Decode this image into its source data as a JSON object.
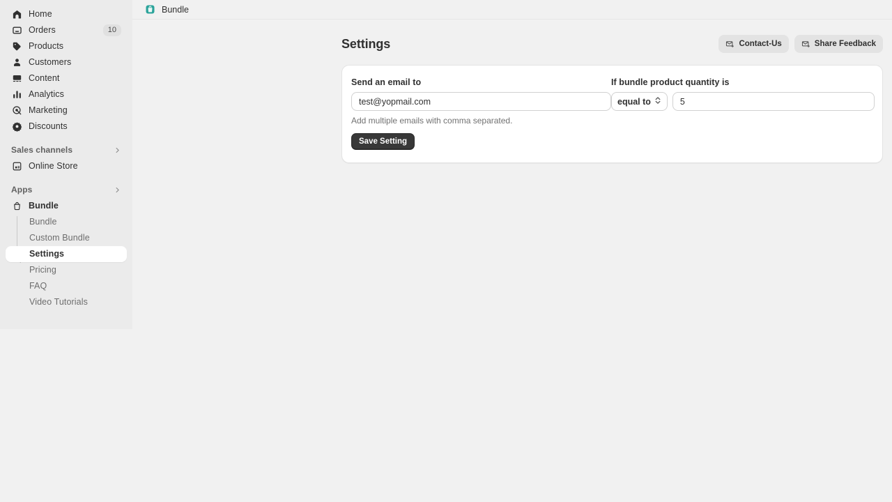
{
  "topbar": {
    "app_icon": "shopping-bag-icon",
    "app_title": "Bundle",
    "icon_color": "#2aa39a"
  },
  "sidebar": {
    "nav_items": [
      {
        "icon": "home-icon",
        "label": "Home",
        "badge": null
      },
      {
        "icon": "orders-icon",
        "label": "Orders",
        "badge": "10"
      },
      {
        "icon": "products-icon",
        "label": "Products",
        "badge": null
      },
      {
        "icon": "customers-icon",
        "label": "Customers",
        "badge": null
      },
      {
        "icon": "content-icon",
        "label": "Content",
        "badge": null
      },
      {
        "icon": "analytics-icon",
        "label": "Analytics",
        "badge": null
      },
      {
        "icon": "marketing-icon",
        "label": "Marketing",
        "badge": null
      },
      {
        "icon": "discounts-icon",
        "label": "Discounts",
        "badge": null
      }
    ],
    "sales_channels": {
      "header": "Sales channels",
      "chevron": "chevron-right-icon",
      "items": [
        {
          "icon": "store-icon",
          "label": "Online Store"
        }
      ]
    },
    "apps": {
      "header": "Apps",
      "chevron": "chevron-right-icon",
      "app": {
        "icon": "shopping-bag-icon",
        "label": "Bundle"
      },
      "sub_items": [
        {
          "label": "Bundle",
          "active": false
        },
        {
          "label": "Custom Bundle",
          "active": false
        },
        {
          "label": "Settings",
          "active": true
        },
        {
          "label": "Pricing",
          "active": false
        },
        {
          "label": "FAQ",
          "active": false
        },
        {
          "label": "Video Tutorials",
          "active": false
        }
      ]
    }
  },
  "page": {
    "title": "Settings",
    "actions": [
      {
        "icon": "envelope-plus-icon",
        "label": "Contact-Us"
      },
      {
        "icon": "envelope-plus-icon",
        "label": "Share Feedback"
      }
    ]
  },
  "settings_card": {
    "email": {
      "label": "Send an email to",
      "value": "test@yopmail.com",
      "placeholder": "Enter email",
      "help": "Add multiple emails with comma separated."
    },
    "quantity": {
      "label": "If bundle product quantity is",
      "operator_value": "equal to",
      "operator_icon": "select-caret-icon",
      "value": "5",
      "placeholder": "Quantity"
    },
    "save_label": "Save Setting"
  }
}
